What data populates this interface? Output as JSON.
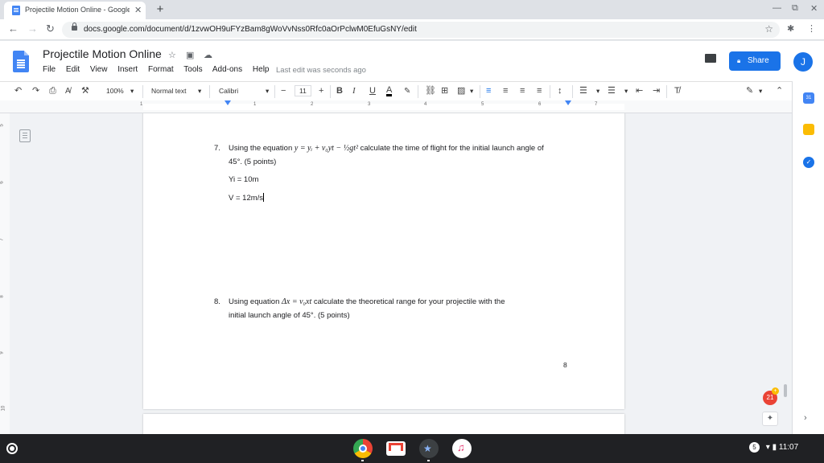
{
  "browser": {
    "tab_title": "Projectile Motion Online - Google",
    "tab_close": "✕",
    "new_tab": "+",
    "url": "docs.google.com/document/d/1zvwOH9uFYzBam8gWoVvNss0Rfc0aOrPclwM0EfuGsNY/edit",
    "window": {
      "minimize": "—",
      "restore": "⧉",
      "close": "✕"
    }
  },
  "docs": {
    "title": "Projectile Motion Online",
    "menu": [
      "File",
      "Edit",
      "View",
      "Insert",
      "Format",
      "Tools",
      "Add-ons",
      "Help"
    ],
    "last_edit": "Last edit was seconds ago",
    "share_label": "Share",
    "avatar_initial": "J"
  },
  "format_toolbar": {
    "zoom": "100%",
    "style": "Normal text",
    "font": "Calibri",
    "font_size": "11",
    "bold": "B",
    "italic": "I",
    "underline": "U",
    "text_color": "A"
  },
  "ruler": {
    "ticks": [
      "1",
      "1",
      "2",
      "3",
      "4",
      "5",
      "6",
      "7"
    ],
    "vticks": [
      "5",
      "6",
      "7",
      "8",
      "9",
      "10"
    ]
  },
  "document": {
    "q7": {
      "number": "7.",
      "pre": "Using the equation",
      "equation": "y = yᵢ + v₀yt − ½gt²",
      "post": "calculate the time of flight for the initial launch angle of",
      "line2": "45°. (5 points)",
      "answer1": "Yi = 10m",
      "answer2": "V = 12m/s"
    },
    "q8": {
      "number": "8.",
      "pre": "Using equation",
      "equation": "Δx = v₀xt",
      "post": "calculate the theoretical range for your projectile with the",
      "line2": "initial launch angle of 45°. (5 points)"
    },
    "page_number": "8"
  },
  "side": {
    "notification_count": "21",
    "chevron": "›"
  },
  "shelf": {
    "notification_badge": "5",
    "time": "11:07"
  },
  "colors": {
    "accent": "#1a73e8",
    "docs_blue": "#4285f4",
    "shelf": "#202124"
  }
}
